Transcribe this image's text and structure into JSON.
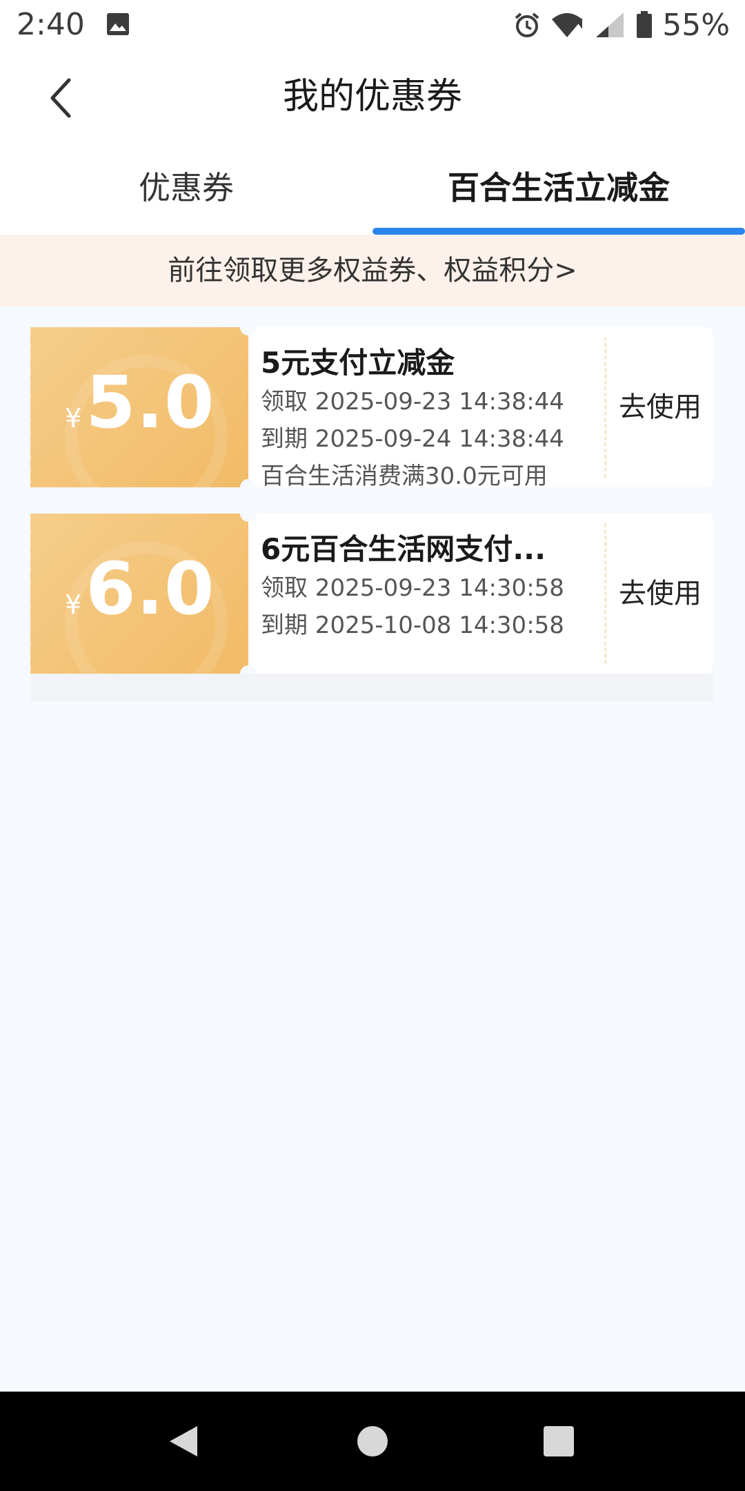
{
  "status_bar": {
    "time": "2:40",
    "battery": "55%",
    "icons": [
      "image-icon",
      "alarm-icon",
      "wifi-icon",
      "signal-icon",
      "battery-icon"
    ]
  },
  "header": {
    "title": "我的优惠券",
    "back_icon": "chevron-left-icon"
  },
  "tabs": [
    {
      "label": "优惠券",
      "selected": false
    },
    {
      "label": "百合生活立减金",
      "selected": true
    }
  ],
  "colors": {
    "accent": "#2b86ec",
    "coupon_gold": "#f1bb67",
    "banner_bg": "#fdf1eb"
  },
  "promo_banner": "前往领取更多权益券、权益积分>",
  "coupons": [
    {
      "currency": "¥",
      "amount": "5.0",
      "title": "5元支付立减金",
      "received": "领取 2025-09-23 14:38:44",
      "expires": "到期 2025-09-24 14:38:44",
      "condition": "百合生活消费满30.0元可用",
      "action": "去使用"
    },
    {
      "currency": "¥",
      "amount": "6.0",
      "title": "6元百合生活网支付...",
      "received": "领取 2025-09-23 14:30:58",
      "expires": "到期 2025-10-08 14:30:58",
      "action": "去使用"
    }
  ],
  "nav_bar": {
    "icons": [
      "back-triangle-icon",
      "home-circle-icon",
      "recents-square-icon"
    ]
  }
}
